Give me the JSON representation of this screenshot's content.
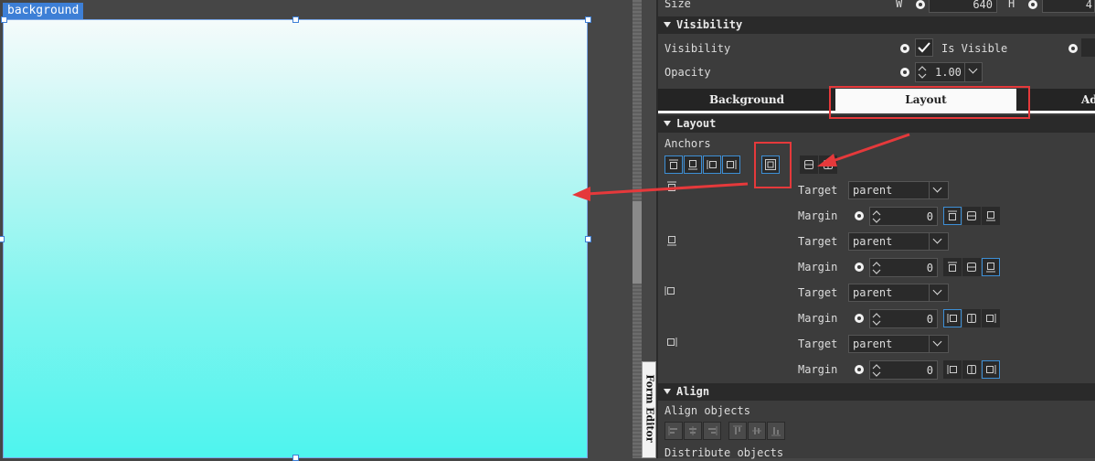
{
  "canvas": {
    "object_label": "background",
    "gradient_top": "#f5fbfb",
    "gradient_bottom": "#4ef4ee"
  },
  "form_editor_tab": "Form Editor",
  "size_row": {
    "label": "Size",
    "w_label": "W",
    "w_value": "640",
    "h_label": "H",
    "h_value": "4"
  },
  "visibility_section": {
    "title": "Visibility",
    "visibility_label": "Visibility",
    "is_visible_label": "Is Visible",
    "is_visible_checked": true,
    "opacity_label": "Opacity",
    "opacity_value": "1.00"
  },
  "tabs": [
    {
      "label": "Background",
      "active": false
    },
    {
      "label": "Layout",
      "active": true
    },
    {
      "label": "Adv",
      "active": false
    }
  ],
  "layout_section": {
    "title": "Layout",
    "anchors_label": "Anchors",
    "rows": [
      {
        "target_label": "Target",
        "target_value": "parent",
        "margin_label": "Margin",
        "margin_value": "0",
        "active_index": 0
      },
      {
        "target_label": "Target",
        "target_value": "parent",
        "margin_label": "Margin",
        "margin_value": "0",
        "active_index": 2
      },
      {
        "target_label": "Target",
        "target_value": "parent",
        "margin_label": "Margin",
        "margin_value": "0",
        "active_index": 0
      },
      {
        "target_label": "Target",
        "target_value": "parent",
        "margin_label": "Margin",
        "margin_value": "0",
        "active_index": 2
      }
    ]
  },
  "align_section": {
    "title": "Align",
    "align_objects_label": "Align objects",
    "distribute_objects_label": "Distribute objects"
  },
  "colors": {
    "accent": "#3d8fd6",
    "highlight_red": "#e5393b",
    "panel_bg": "#3c3c3c",
    "header_bg": "#2a2a2a"
  }
}
